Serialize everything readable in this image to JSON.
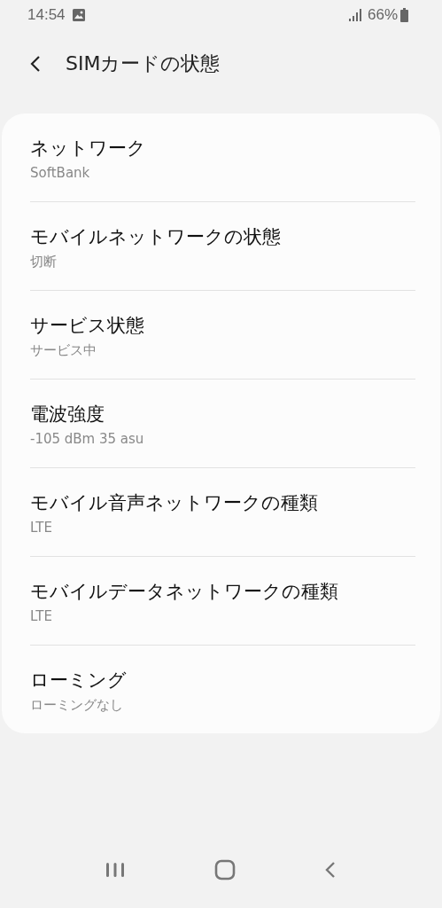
{
  "status_bar": {
    "time": "14:54",
    "battery": "66%"
  },
  "header": {
    "title": "SIMカードの状態"
  },
  "items": [
    {
      "title": "ネットワーク",
      "value": "SoftBank"
    },
    {
      "title": "モバイルネットワークの状態",
      "value": "切断"
    },
    {
      "title": "サービス状態",
      "value": "サービス中"
    },
    {
      "title": "電波強度",
      "value": "-105 dBm 35 asu"
    },
    {
      "title": "モバイル音声ネットワークの種類",
      "value": "LTE"
    },
    {
      "title": "モバイルデータネットワークの種類",
      "value": "LTE"
    },
    {
      "title": "ローミング",
      "value": "ローミングなし"
    }
  ]
}
